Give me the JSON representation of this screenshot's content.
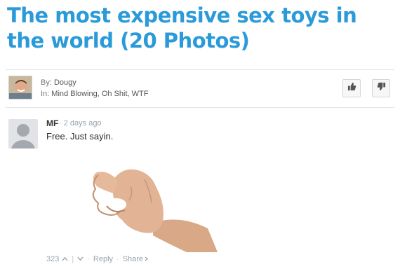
{
  "article": {
    "title": "The most expensive sex toys in the world (20 Photos)",
    "by_label": "By:",
    "author": "Dougy",
    "in_label": "In:",
    "categories": "Mind Blowing, Oh Shit, WTF"
  },
  "vote": {
    "up_icon": "thumbs-up-icon",
    "down_icon": "thumbs-down-icon"
  },
  "comment": {
    "author": "MF",
    "time": "2 days ago",
    "text": "Free. Just sayin.",
    "image": "hand-ok-gesture",
    "upvotes": "323",
    "reply_label": "Reply",
    "share_label": "Share"
  },
  "colors": {
    "title": "#2a9ad8",
    "muted": "#9aa3ab"
  }
}
